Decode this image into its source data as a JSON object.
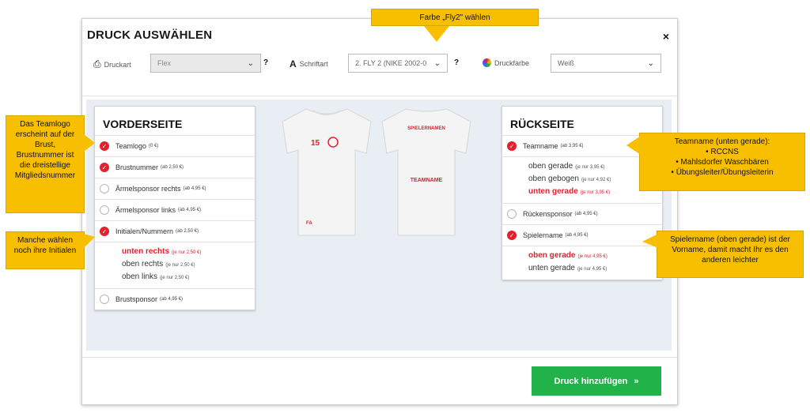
{
  "modal": {
    "title": "DRUCK AUSWÄHLEN",
    "close": "×",
    "druckart_label": "Druckart",
    "druckart_value": "Flex",
    "schriftart_label": "Schriftart",
    "schriftart_value": "2. FLY 2 (NIKE 2002-0",
    "druckfarbe_label": "Druckfarbe",
    "druckfarbe_value": "Weiß",
    "help": "?",
    "add_button": "Druck hinzufügen",
    "add_button_icon": "»"
  },
  "front": {
    "title": "VORDERSEITE",
    "items": [
      {
        "label": "Teamlogo",
        "price": "(0 €)",
        "checked": true
      },
      {
        "label": "Brustnummer",
        "price": "(ab 2,50 €)",
        "checked": true
      },
      {
        "label": "Ärmelsponsor rechts",
        "price": "(ab 4,95 €)",
        "checked": false
      },
      {
        "label": "Ärmelsponsor links",
        "price": "(ab 4,95 €)",
        "checked": false
      },
      {
        "label": "Initialen/Nummern",
        "price": "(ab 2,50 €)",
        "checked": true
      }
    ],
    "initial_options": [
      {
        "label": "unten rechts",
        "price": "(je nur 2,50 €)",
        "active": true
      },
      {
        "label": "oben rechts",
        "price": "(je nur 2,50 €)",
        "active": false
      },
      {
        "label": "oben links",
        "price": "(je nur 2,50 €)",
        "active": false
      }
    ],
    "last_item": {
      "label": "Brustsponsor",
      "price": "(ab 4,95 €)",
      "checked": false
    }
  },
  "back": {
    "title": "RÜCKSEITE",
    "teamname": {
      "label": "Teamname",
      "price": "(ab 3,95 €)"
    },
    "teamname_options": [
      {
        "label": "oben gerade",
        "price": "(je nur 3,95 €)",
        "active": false
      },
      {
        "label": "oben gebogen",
        "price": "(je nur 4,92 €)",
        "active": false
      },
      {
        "label": "unten gerade",
        "price": "(je nur 3,95 €)",
        "active": true
      }
    ],
    "rueckensponsor": {
      "label": "Rückensponsor",
      "price": "(ab 4,95 €)"
    },
    "spielername": {
      "label": "Spielername",
      "price": "(ab 4,95 €)"
    },
    "spielername_options": [
      {
        "label": "oben gerade",
        "price": "(je nur 4,95 €)",
        "active": true
      },
      {
        "label": "unten gerade",
        "price": "(je nur 4,95 €)",
        "active": false
      }
    ]
  },
  "shirt_front": {
    "number": "15",
    "initials": "FA"
  },
  "shirt_back": {
    "player": "SPIELERNAMEN",
    "team": "TEAMNAME"
  },
  "callouts": {
    "farbe": "Farbe „Fly2\" wählen",
    "teamlogo": "Das Teamlogo erscheint auf der Brust, Brustnummer ist die dreistellige Mitgliedsnummer",
    "initialen": "Manche wählen noch ihre Initialen",
    "teamname_title": "Teamname (unten gerade):",
    "teamname_items": [
      "RCCNS",
      "Mahlsdorfer Waschbären",
      "Übungsleiter/Übungsleiterin"
    ],
    "spielername": "Spielername (oben gerade) ist der Vorname, damit macht Ihr es den anderen leichter"
  },
  "colors": {
    "accent_red": "#e3202e",
    "button_green": "#21b24a",
    "callout_yellow": "#f8bf00"
  }
}
